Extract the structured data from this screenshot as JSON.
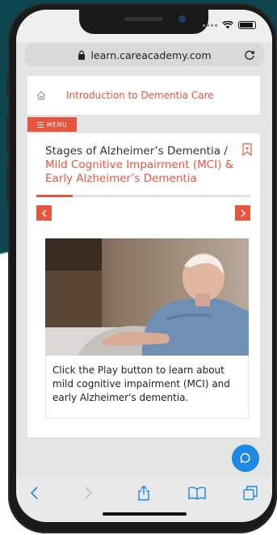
{
  "browser": {
    "url": "learn.careacademy.com"
  },
  "site": {
    "course_title": "Introduction to Dementia Care",
    "menu_label": "MENU"
  },
  "lesson": {
    "title": "Stages of Alzheimer’s Dementia /",
    "subtitle": "Mild Cognitive Impairment (MCI) & Early Alzheimer’s Dementia",
    "progress_fraction": 0.17,
    "caption": "Click the Play button to learn about mild cognitive impairment (MCI) and early Alzheimer's dementia."
  },
  "icons": {
    "lock": "lock-icon",
    "reload": "reload-icon",
    "home": "home-icon",
    "menu": "hamburger-icon",
    "bookmark": "bookmark-icon",
    "prev": "chevron-left-icon",
    "next": "chevron-right-icon",
    "chat": "chat-bubble-icon",
    "back": "back-arrow-icon",
    "forward": "forward-arrow-icon",
    "share": "share-icon",
    "bookmarks": "open-book-icon",
    "tabs": "tabs-icon"
  },
  "colors": {
    "accent": "#e8553d",
    "chat_button": "#1e88e5",
    "background_teal": "#0e4650",
    "toolbar_blue": "#1e88e5"
  }
}
